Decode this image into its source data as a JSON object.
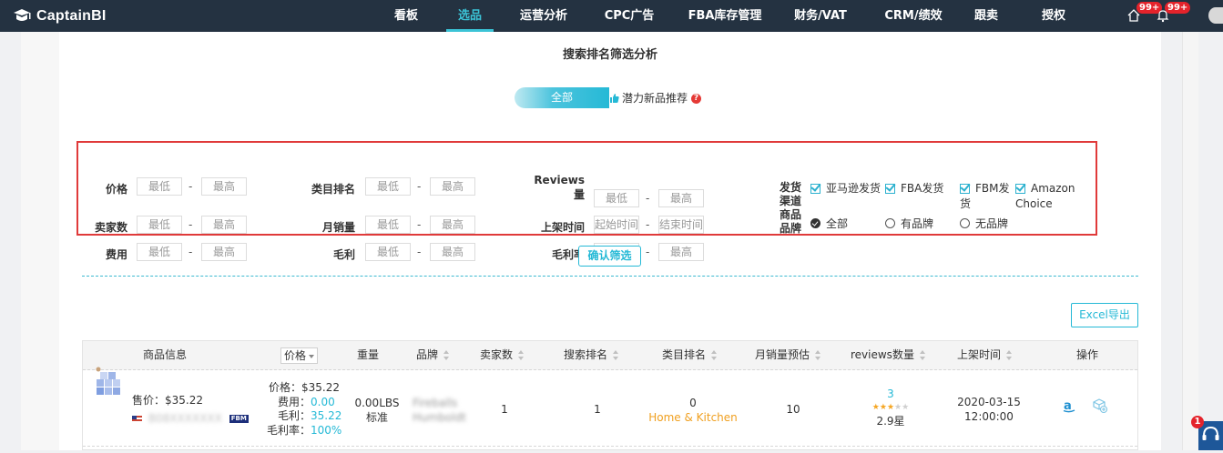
{
  "app": {
    "logo_text": "CaptainBI"
  },
  "nav": {
    "items": [
      "看板",
      "选品",
      "运营分析",
      "CPC广告",
      "FBA库存管理",
      "财务/VAT",
      "CRM/绩效",
      "跟卖",
      "授权"
    ],
    "active_index": 1,
    "badges": [
      "99+",
      "99+"
    ]
  },
  "page": {
    "title": "搜索排名筛选分析",
    "segment_all": "全部",
    "segment_potential": "潜力新品推荐",
    "help_glyph": "?"
  },
  "filters": {
    "min_placeholder": "最低",
    "max_placeholder": "最高",
    "start_placeholder": "起始时间",
    "end_placeholder": "结束时间",
    "dash": "-",
    "price": "价格",
    "seller_count": "卖家数",
    "fee": "费用",
    "category_rank": "类目排名",
    "monthly_sales": "月销量",
    "gross_profit": "毛利",
    "reviews_1": "Reviews",
    "reviews_2": "量",
    "listed_time": "上架时间",
    "margin_rate": "毛利率",
    "shipping_1": "发货",
    "shipping_2": "渠道",
    "brand_1": "商品",
    "brand_2": "品牌",
    "ship_amazon": "亚马逊发货",
    "ship_fba": "FBA发货",
    "ship_fbm_1": "FBM发",
    "ship_fbm_2": "货",
    "ship_choice_1": "Amazon",
    "ship_choice_2": "Choice",
    "brand_all": "全部",
    "brand_has": "有品牌",
    "brand_none": "无品牌",
    "confirm": "确认筛选"
  },
  "export_label": "Excel导出",
  "table": {
    "headers": {
      "product": "商品信息",
      "price": "价格",
      "weight": "重量",
      "brand": "品牌",
      "sellers": "卖家数",
      "search_rank": "搜索排名",
      "category_rank": "类目排名",
      "monthly_sales": "月销量预估",
      "reviews": "reviews数量",
      "listed": "上架时间",
      "actions": "操作"
    },
    "rows": [
      {
        "sale_price": "售价：$35.22",
        "asin": "B08XXXXXXX",
        "fbm_tag": "FBM",
        "price_line": "价格：$35.22",
        "fee_label": "费用：",
        "fee_value": "0.00",
        "profit_label": "毛利：",
        "profit_value": "35.22",
        "margin_label": "毛利率：",
        "margin_value": "100%",
        "weight": "0.00LBS",
        "size_tier": "标准",
        "brand_line1": "Fireballs",
        "brand_line2": "Humboldt",
        "sellers": "1",
        "search_rank": "1",
        "category_rank": "0",
        "category": "Home & Kitchen",
        "monthly_sales": "10",
        "reviews": "3",
        "rating": "2.9星",
        "stars_on": 3,
        "stars_total": 5,
        "date": "2020-03-15",
        "time": "12:00:00"
      }
    ]
  },
  "helpdesk_badge": "1"
}
